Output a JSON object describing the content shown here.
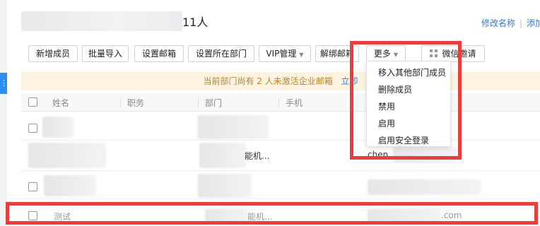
{
  "header": {
    "member_count": "11人",
    "links": [
      "修改名称",
      "添加"
    ]
  },
  "toolbar": {
    "buttons": [
      "新增成员",
      "批量导入",
      "设置邮箱",
      "设置所在部门",
      "VIP管理",
      "解绑邮箱",
      "更多",
      "微信邀请"
    ]
  },
  "notice": {
    "text": "当前部门尚有 2 人未激活企业邮箱",
    "link": "立即"
  },
  "table": {
    "headers": [
      "姓名",
      "职务",
      "部门",
      "手机"
    ],
    "rows": [
      {
        "name": "",
        "department": "",
        "phone": ""
      },
      {
        "name": "",
        "department": "能机...",
        "phone": "chen..."
      },
      {
        "name": "",
        "department": "",
        "phone": ""
      },
      {
        "name": "测试",
        "department": "能机...",
        "phone": ".com"
      }
    ]
  },
  "more_menu": {
    "items": [
      "移入其他部门成员",
      "删除成员",
      "禁用",
      "启用",
      "启用安全登录"
    ]
  },
  "icons": {
    "grid": "qr-grid-icon",
    "caret": "caret-down-icon",
    "more": "dots-icon"
  },
  "colors": {
    "link": "#2f78d8",
    "notice_bg": "#fdf3e0",
    "notice_text": "#b8852a",
    "highlight": "#e83e3e"
  }
}
